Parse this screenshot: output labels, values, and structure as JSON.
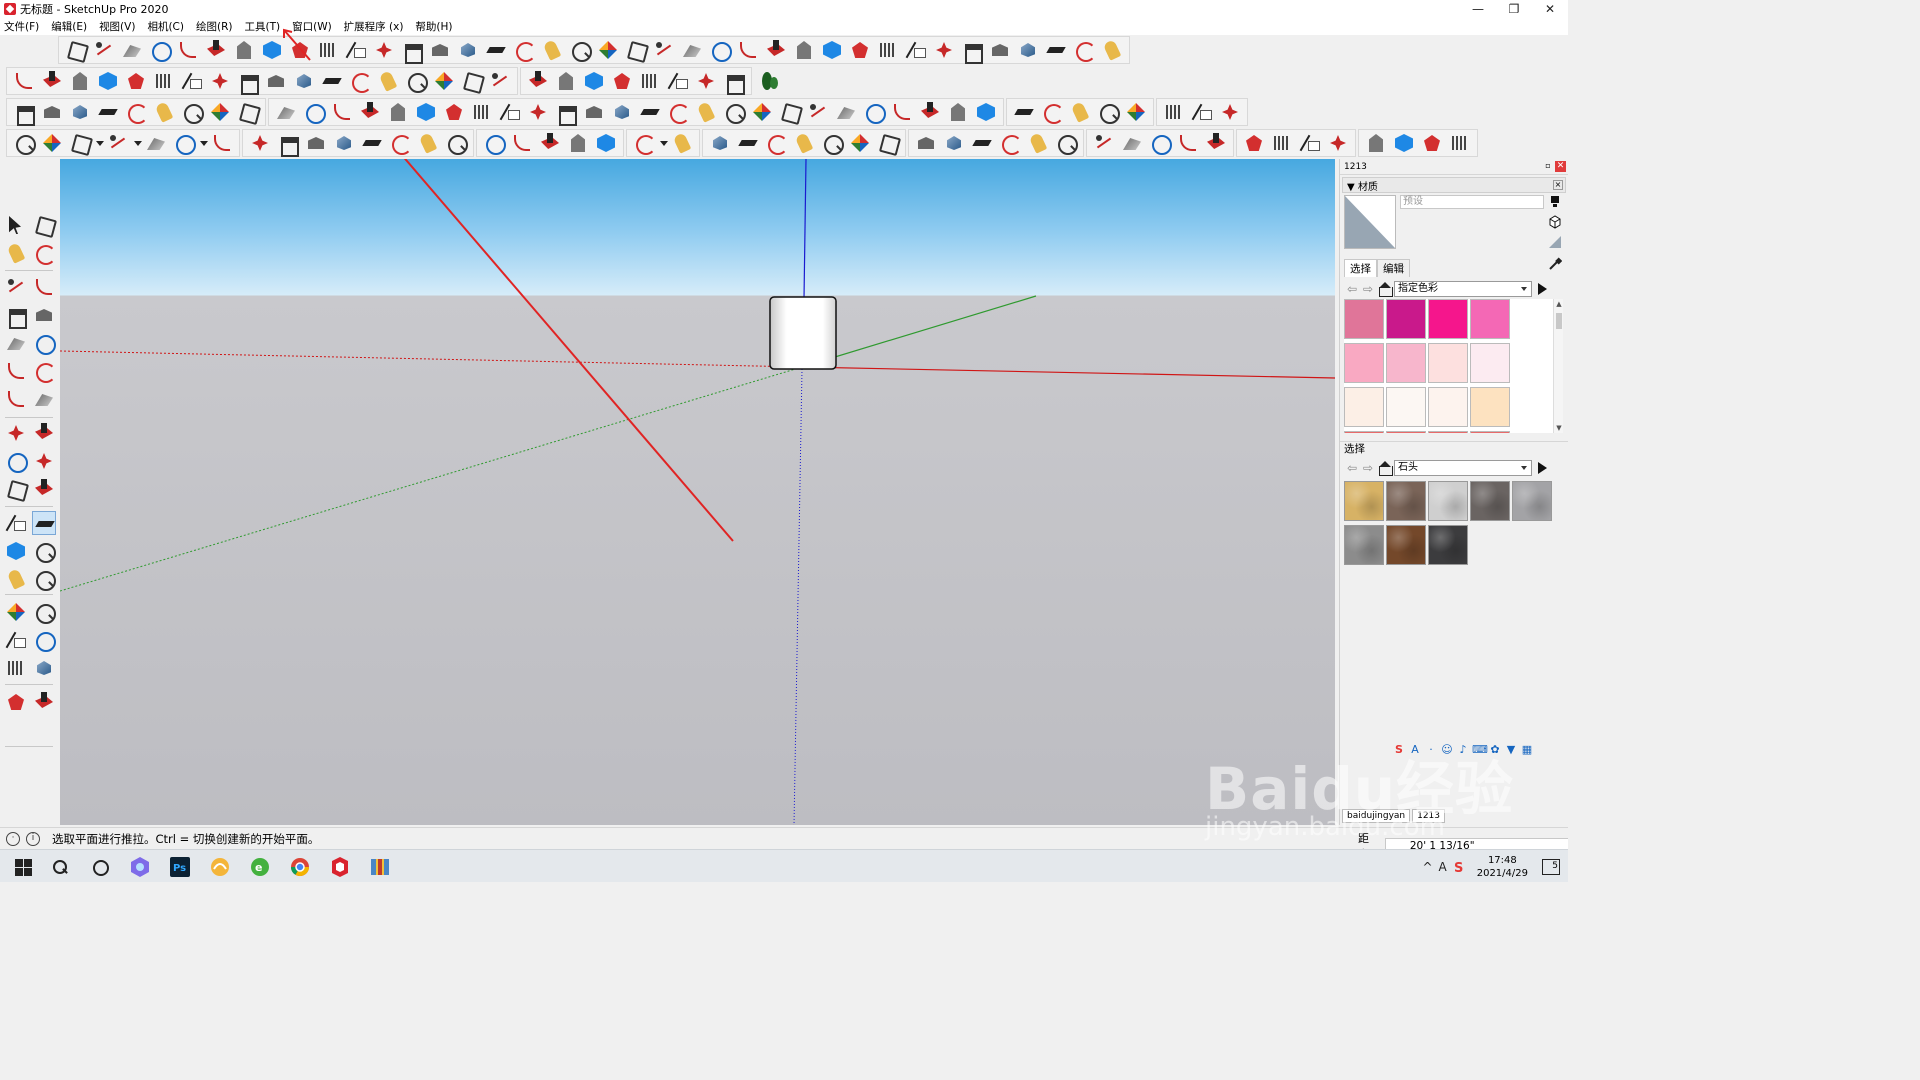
{
  "window": {
    "title": "无标题 - SketchUp Pro 2020",
    "minimize": "—",
    "restore": "❐",
    "close": "✕"
  },
  "menu": [
    "文件(F)",
    "编辑(E)",
    "视图(V)",
    "相机(C)",
    "绘图(R)",
    "工具(T)",
    "窗口(W)",
    "扩展程序 (x)",
    "帮助(H)"
  ],
  "panel": {
    "header": "1213",
    "pin": "▫",
    "close": "✕",
    "materials_tray": "▼ 材质",
    "material_name_placeholder": "预设",
    "tab_select": "选择",
    "tab_edit": "编辑",
    "category_1": "指定色彩",
    "section_select": "选择",
    "category_2": "石头",
    "swatch_colors": [
      "#e07599",
      "#c9198b",
      "#f5168c",
      "#f468b5",
      "#f9a9c2",
      "#f7b6cc",
      "#fde0df",
      "#fcebf1",
      "#fcefe6",
      "#fcf7f3",
      "#fdf3ee",
      "#fde2c0"
    ],
    "texture_colors": [
      "#d7b265",
      "#7a6458",
      "#cfcfcf",
      "#6a6462",
      "#a3a3a6",
      "#8c8c8c",
      "#74482a",
      "#3c3c3e"
    ],
    "footer_tabs": [
      "baidujingyan",
      "1213"
    ]
  },
  "status": {
    "hint": "选取平面进行推拉。Ctrl = 切换创建新的开始平面。",
    "measure_label": "距离",
    "measure_value": "20' 1 13/16\""
  },
  "taskbar": {
    "tray_up": "^",
    "tray_a": "A",
    "time": "17:48",
    "date": "2021/4/29",
    "notifications": "5"
  },
  "watermark": {
    "main": "Baidu经验",
    "sub": "jingyan.baidu.com"
  },
  "colors": {
    "annotation_arrow": "#e02424",
    "axis_red": "#d01515",
    "axis_green": "#2f9a2f",
    "axis_blue": "#1a1ad0"
  }
}
